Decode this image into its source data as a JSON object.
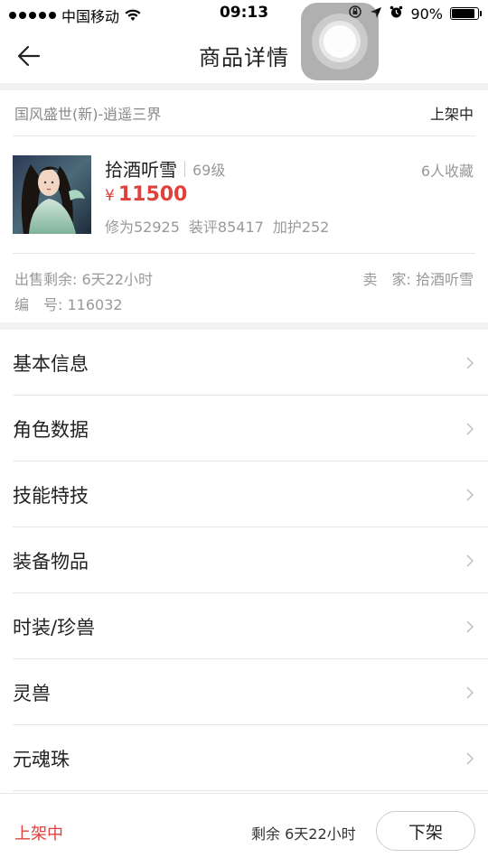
{
  "status_bar": {
    "carrier": "中国移动",
    "time": "09:13",
    "battery": "90%",
    "battery_level": 0.9
  },
  "nav": {
    "title": "商品详情",
    "back_icon": "arrow-left-icon"
  },
  "listing": {
    "server": "国风盛世(新)-逍遥三界",
    "status": "上架中"
  },
  "item": {
    "name": "拾酒听雪",
    "level": "69级",
    "favorites": "6人收藏",
    "currency": "¥",
    "price": "11500",
    "stats": [
      "修为52925",
      "装评85417",
      "加护252"
    ]
  },
  "sale": {
    "remaining": "出售剩余: 6天22小时",
    "seller": "卖　家: 拾酒听雪",
    "serial": "编　号: 116032"
  },
  "menu": [
    {
      "label": "基本信息"
    },
    {
      "label": "角色数据"
    },
    {
      "label": "技能特技"
    },
    {
      "label": "装备物品"
    },
    {
      "label": "时装/珍兽"
    },
    {
      "label": "灵兽"
    },
    {
      "label": "元魂珠"
    }
  ],
  "bottom": {
    "status": "上架中",
    "remaining": "剩余 6天22小时",
    "action": "下架"
  },
  "colors": {
    "accent": "#e0413b",
    "muted": "#999999",
    "divider": "#e6e6e6"
  }
}
